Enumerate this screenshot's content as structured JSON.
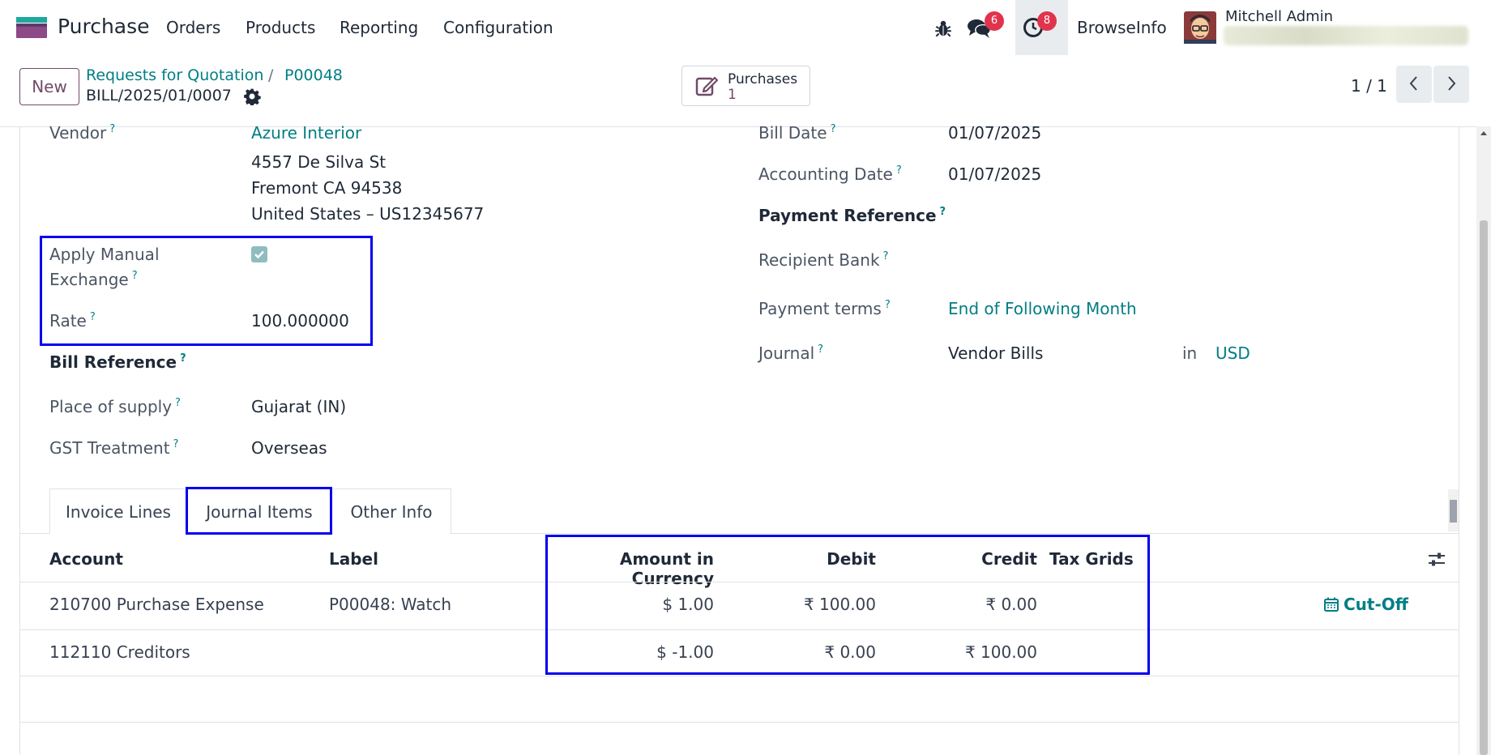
{
  "navbar": {
    "app_name": "Purchase",
    "menu": [
      "Orders",
      "Products",
      "Reporting",
      "Configuration"
    ],
    "messages_count": "6",
    "activities_count": "8",
    "company": "BrowseInfo",
    "user_name": "Mitchell Admin"
  },
  "control": {
    "new_label": "New",
    "breadcrumb": [
      "Requests for Quotation",
      "P00048"
    ],
    "breadcrumb_sep": "/",
    "record_name": "BILL/2025/01/0007",
    "smart_button": {
      "label": "Purchases",
      "count": "1"
    },
    "pager": "1 / 1"
  },
  "form": {
    "vendor_label": "Vendor",
    "vendor_name": "Azure Interior",
    "vendor_address": [
      "4557 De Silva St",
      "Fremont CA 94538",
      "United States – US12345677"
    ],
    "manual_exchange_label_1": "Apply Manual",
    "manual_exchange_label_2": "Exchange",
    "manual_exchange_checked": true,
    "rate_label": "Rate",
    "rate_value": "100.000000",
    "bill_reference_label": "Bill Reference",
    "place_of_supply_label": "Place of supply",
    "place_of_supply_value": "Gujarat (IN)",
    "gst_treatment_label": "GST Treatment",
    "gst_treatment_value": "Overseas",
    "bill_date_label": "Bill Date",
    "bill_date_value": "01/07/2025",
    "accounting_date_label": "Accounting Date",
    "accounting_date_value": "01/07/2025",
    "payment_reference_label": "Payment Reference",
    "recipient_bank_label": "Recipient Bank",
    "payment_terms_label": "Payment terms",
    "payment_terms_value": "End of Following Month",
    "journal_label": "Journal",
    "journal_value": "Vendor Bills",
    "journal_in": "in",
    "currency": "USD",
    "help_mark": "?"
  },
  "tabs": [
    "Invoice Lines",
    "Journal Items",
    "Other Info"
  ],
  "active_tab": "Journal Items",
  "journal_items": {
    "columns": [
      "Account",
      "Label",
      "Amount in Currency",
      "Debit",
      "Credit",
      "Tax Grids"
    ],
    "rows": [
      {
        "account": "210700 Purchase Expense",
        "label": "P00048: Watch",
        "amount_currency": "$ 1.00",
        "debit": "₹ 100.00",
        "credit": "₹ 0.00",
        "tax_grids": ""
      },
      {
        "account": "112110 Creditors",
        "label": "",
        "amount_currency": "$ -1.00",
        "debit": "₹ 0.00",
        "credit": "₹ 100.00",
        "tax_grids": ""
      }
    ],
    "cutoff_label": "Cut-Off"
  },
  "colors": {
    "brand": "#714b67",
    "link": "#017e84",
    "badge": "#e0344d",
    "highlight": "#0000ee"
  }
}
